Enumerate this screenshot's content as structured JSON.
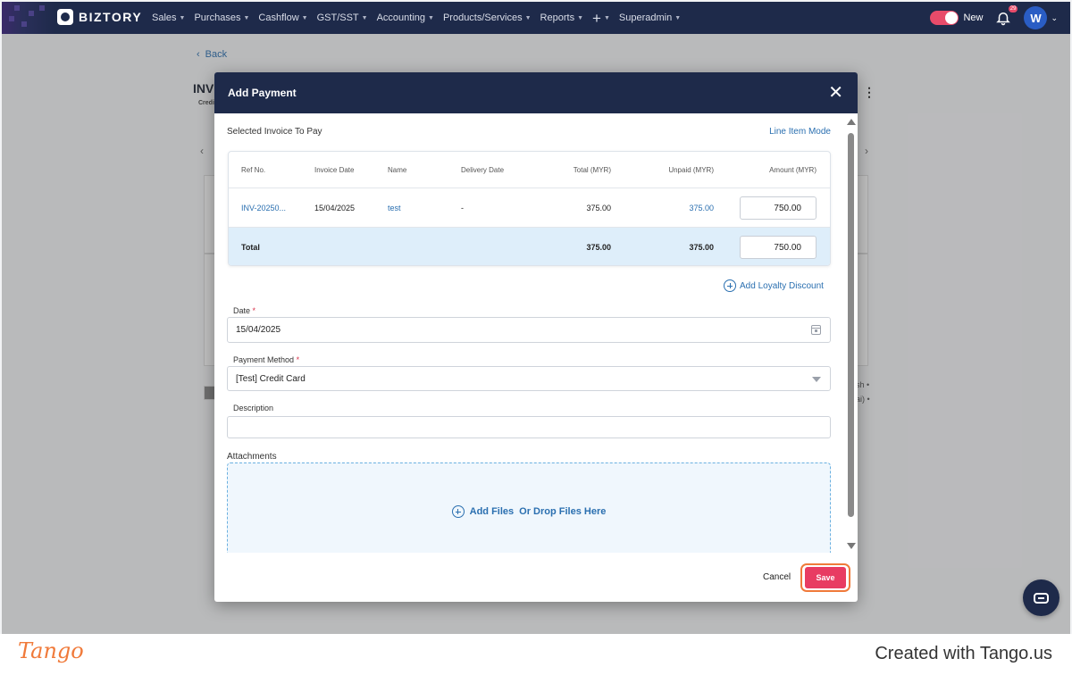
{
  "nav": {
    "brand": "BIZTORY",
    "items": [
      {
        "label": "Sales"
      },
      {
        "label": "Purchases"
      },
      {
        "label": "Cashflow"
      },
      {
        "label": "GST/SST"
      },
      {
        "label": "Accounting"
      },
      {
        "label": "Products/Services"
      },
      {
        "label": "Reports"
      }
    ],
    "superadmin": "Superadmin",
    "toggle_label": "New",
    "notif_count": "29",
    "avatar": "W"
  },
  "background": {
    "back": "Back",
    "title": "INV",
    "subtitle": "Credi",
    "side_text1": "sh •",
    "side_text2": "ai) •"
  },
  "modal": {
    "title": "Add Payment",
    "selected_title": "Selected Invoice To Pay",
    "line_item_mode": "Line Item Mode",
    "table": {
      "headers": [
        "Ref No.",
        "Invoice Date",
        "Name",
        "Delivery Date",
        "Total (MYR)",
        "Unpaid (MYR)",
        "Amount (MYR)"
      ],
      "row": {
        "ref": "INV-20250...",
        "date": "15/04/2025",
        "name": "test",
        "delivery": "-",
        "total": "375.00",
        "unpaid": "375.00",
        "amount": "750.00"
      },
      "total_row": {
        "label": "Total",
        "total": "375.00",
        "unpaid": "375.00",
        "amount": "750.00"
      }
    },
    "add_loyalty": "Add Loyalty Discount",
    "date_label": "Date",
    "date_value": "15/04/2025",
    "payment_method_label": "Payment Method",
    "payment_method_value": "[Test] Credit Card",
    "description_label": "Description",
    "description_value": "",
    "attachments_label": "Attachments",
    "add_files": "Add Files",
    "drop_files": "Or Drop Files Here",
    "cancel": "Cancel",
    "save": "Save",
    "required_mark": "*"
  },
  "footer": {
    "logo": "Tango",
    "credit": "Created with Tango.us"
  },
  "colors": {
    "nav_bg": "#1e2a4a",
    "accent_link": "#2a6fb0",
    "save_bg": "#e83c62",
    "highlight_ring": "#f07a3a",
    "total_row_bg": "#deeefa"
  }
}
